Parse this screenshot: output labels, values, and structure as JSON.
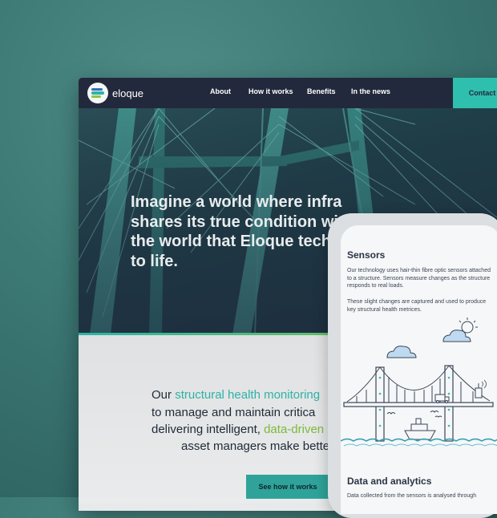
{
  "site": {
    "brand": "eloque",
    "nav": [
      "About",
      "How it works",
      "Benefits",
      "In the news"
    ],
    "contact_label": "Contact"
  },
  "hero": {
    "lines": [
      "Imagine a world where infra",
      "shares its true condition wit",
      "the world that Eloque techn",
      "to life."
    ]
  },
  "mission": {
    "line1_a": "Our ",
    "line1_b": "structural health monitoring",
    "line2": "to manage and maintain critica",
    "line3_a": "delivering intelligent, ",
    "line3_b": "data-driven",
    "line4": "asset managers make bette",
    "cta_label": "See how it works"
  },
  "mobile": {
    "sensors_title": "Sensors",
    "sensors_p1": "Our technology uses hair-thin fibre optic sensors attached to a structure. Sensors measure changes as the structure responds to real loads.",
    "sensors_p2": "These slight changes are captured and used to produce key structural health metrices.",
    "data_title": "Data and analytics",
    "data_p1": "Data collected from the sensors is analysed through"
  },
  "colors": {
    "nav_bg": "#23293c",
    "accent_teal": "#2fbfae",
    "accent_green": "#8cc63f",
    "page_bg": "#3d7a76"
  },
  "icons": [
    "eloque-logo-icon",
    "cloud-icon",
    "sun-cloud-icon",
    "bridge-illustration",
    "ship-icon",
    "truck-icon",
    "bird-icon"
  ]
}
